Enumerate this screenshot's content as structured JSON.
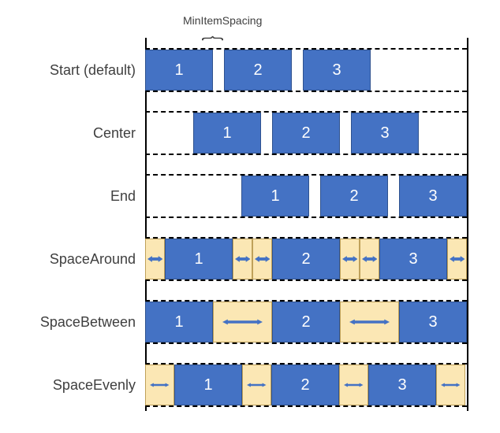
{
  "callout": "MinItemSpacing",
  "items": [
    "1",
    "2",
    "3"
  ],
  "rows": [
    {
      "id": "start",
      "label": "Start (default)"
    },
    {
      "id": "center",
      "label": "Center"
    },
    {
      "id": "end",
      "label": "End"
    },
    {
      "id": "around",
      "label": "SpaceAround"
    },
    {
      "id": "between",
      "label": "SpaceBetween"
    },
    {
      "id": "evenly",
      "label": "SpaceEvenly"
    }
  ]
}
